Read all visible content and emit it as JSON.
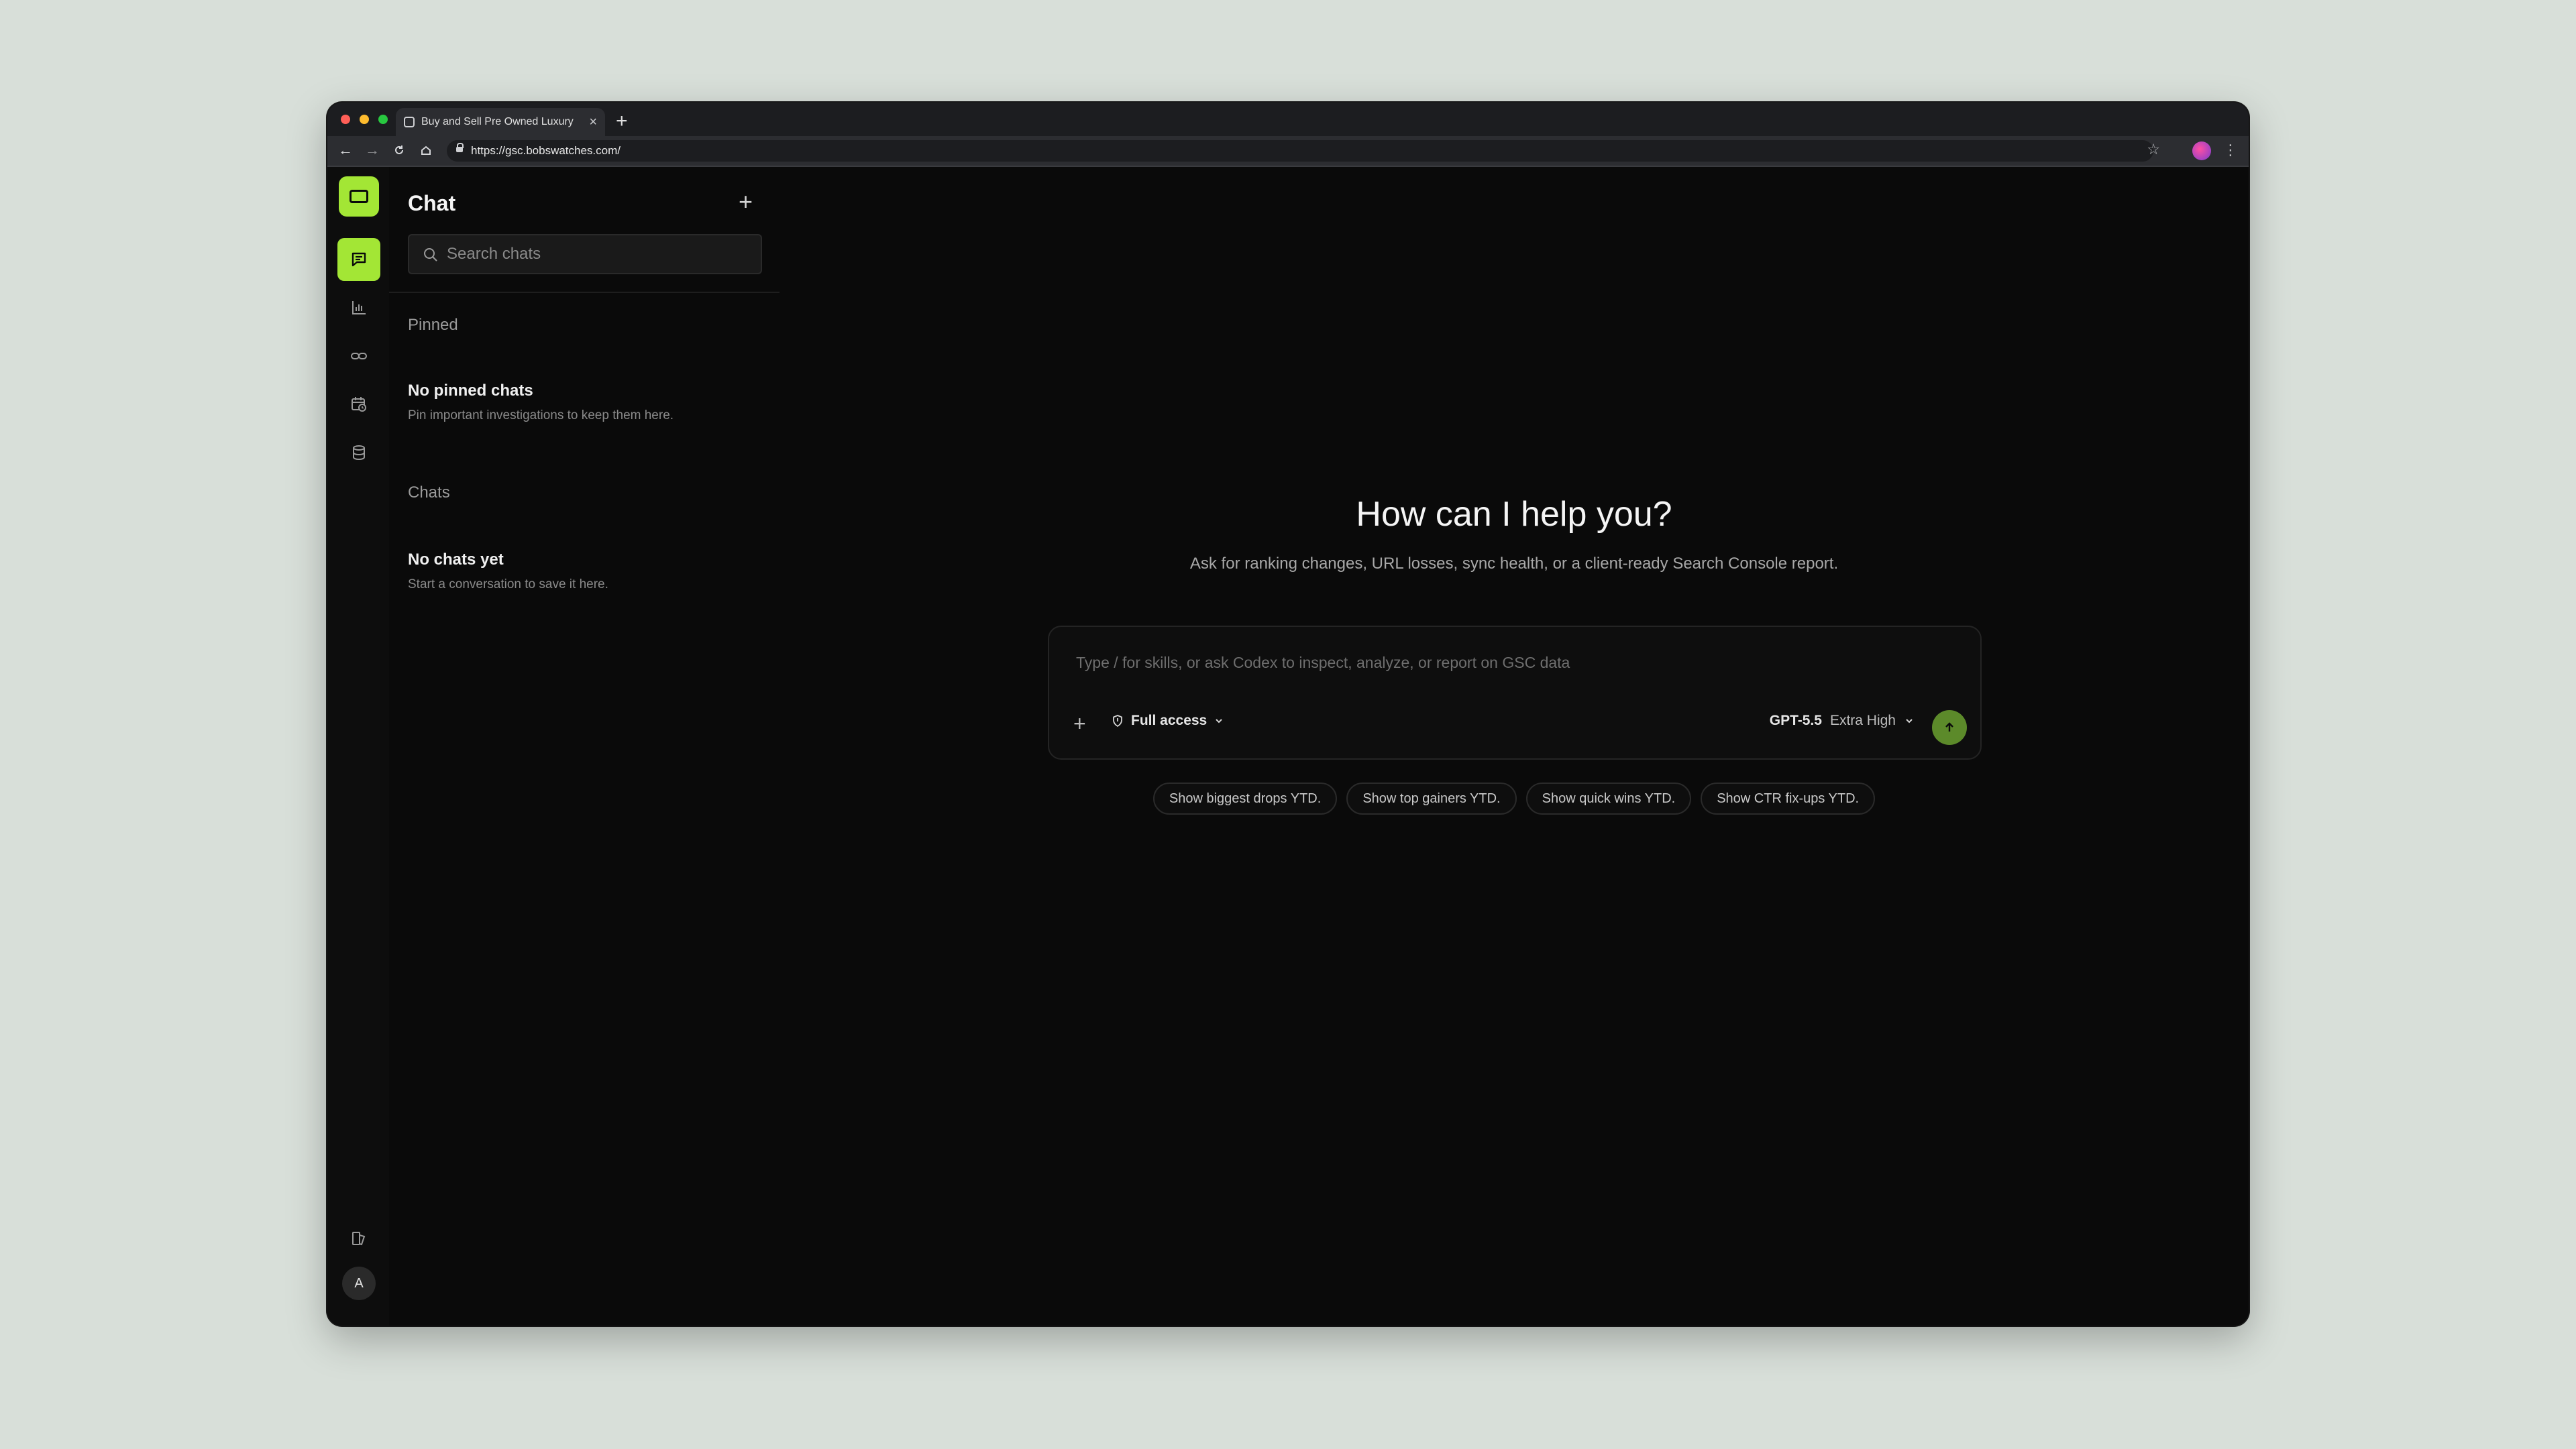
{
  "browser": {
    "tab_title": "Buy and Sell Pre Owned Luxury",
    "url": "https://gsc.bobswatches.com/"
  },
  "rail": {
    "items": [
      {
        "name": "chat-icon",
        "active": true
      },
      {
        "name": "analytics-icon",
        "active": false
      },
      {
        "name": "link-icon",
        "active": false
      },
      {
        "name": "calendar-icon",
        "active": false
      },
      {
        "name": "database-icon",
        "active": false
      }
    ],
    "bottom": {
      "docs_icon": "book-icon",
      "avatar_letter": "A"
    },
    "accent": "#a3e635"
  },
  "sidebar": {
    "title": "Chat",
    "search_placeholder": "Search chats",
    "pinned": {
      "heading": "Pinned",
      "empty_title": "No pinned chats",
      "empty_sub": "Pin important investigations to keep them here."
    },
    "chats": {
      "heading": "Chats",
      "empty_title": "No chats yet",
      "empty_sub": "Start a conversation to save it here."
    }
  },
  "main": {
    "title": "How can I help you?",
    "subtitle": "Ask for ranking changes, URL losses, sync health, or a client-ready Search Console report.",
    "composer": {
      "placeholder": "Type / for skills, or ask Codex to inspect, analyze, or report on GSC data",
      "access_label": "Full access",
      "model_name": "GPT-5.5",
      "model_level": "Extra High",
      "send_color": "#5c8a2a"
    },
    "suggestions": [
      "Show biggest drops YTD.",
      "Show top gainers YTD.",
      "Show quick wins YTD.",
      "Show CTR fix-ups YTD."
    ]
  }
}
